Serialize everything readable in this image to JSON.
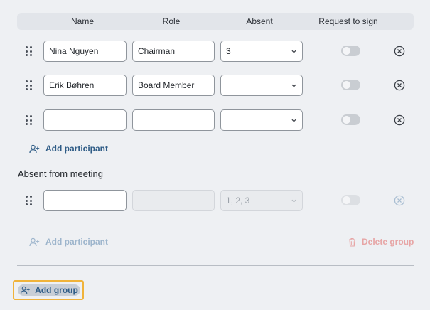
{
  "columns": {
    "name": "Name",
    "role": "Role",
    "absent": "Absent",
    "request_to_sign": "Request to sign"
  },
  "participants": [
    {
      "name": "Nina Nguyen",
      "role": "Chairman",
      "absent": "3",
      "request_to_sign": false
    },
    {
      "name": "Erik Bøhren",
      "role": "Board Member",
      "absent": "",
      "request_to_sign": false
    },
    {
      "name": "",
      "role": "",
      "absent": "",
      "request_to_sign": false
    }
  ],
  "add_participant_label": "Add participant",
  "absent_group": {
    "title": "Absent from meeting",
    "participants": [
      {
        "name": "",
        "role": "",
        "absent": "1, 2, 3",
        "request_to_sign": false
      }
    ],
    "add_participant_label": "Add participant",
    "delete_group_label": "Delete group"
  },
  "add_group_label": "Add group",
  "icons": {
    "drag": "drag-handle-icon",
    "chevron": "chevron-down-icon",
    "remove": "close-circle-icon",
    "add_person": "person-add-icon",
    "trash": "trash-icon"
  },
  "colors": {
    "link": "#2f5c86",
    "focus_outline": "#f0b33a",
    "danger_muted": "#e7a5a5"
  }
}
